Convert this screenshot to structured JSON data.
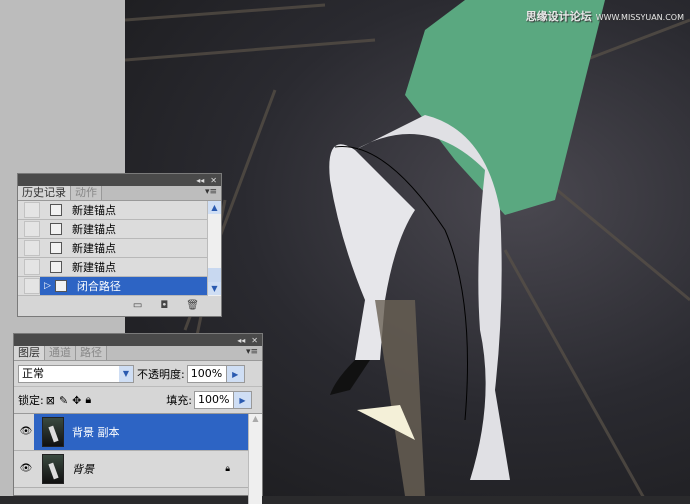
{
  "watermark": {
    "cn": "思缘设计论坛",
    "en": "WWW.MISSYUAN.COM"
  },
  "history_panel": {
    "tabs": [
      {
        "label": "历史记录",
        "active": true
      },
      {
        "label": "动作",
        "active": false
      }
    ],
    "items": [
      {
        "label": "新建锚点"
      },
      {
        "label": "新建锚点"
      },
      {
        "label": "新建锚点"
      },
      {
        "label": "新建锚点"
      },
      {
        "label": "闭合路径",
        "selected": true
      }
    ],
    "footer_icons": [
      "new-document-from-state-icon",
      "camera-snapshot-icon",
      "trash-icon"
    ]
  },
  "layers_panel": {
    "tabs": [
      {
        "label": "图层",
        "active": true
      },
      {
        "label": "通道",
        "active": false
      },
      {
        "label": "路径",
        "active": false
      }
    ],
    "blend_mode": "正常",
    "opacity_label": "不透明度:",
    "opacity": "100%",
    "lock_label": "锁定:",
    "fill_label": "填充:",
    "fill": "100%",
    "layers": [
      {
        "name": "背景 副本",
        "selected": true
      },
      {
        "name": "背景",
        "locked": true
      }
    ]
  },
  "colors": {
    "selection": "#2d64c4",
    "panel": "#d6d6d6"
  }
}
